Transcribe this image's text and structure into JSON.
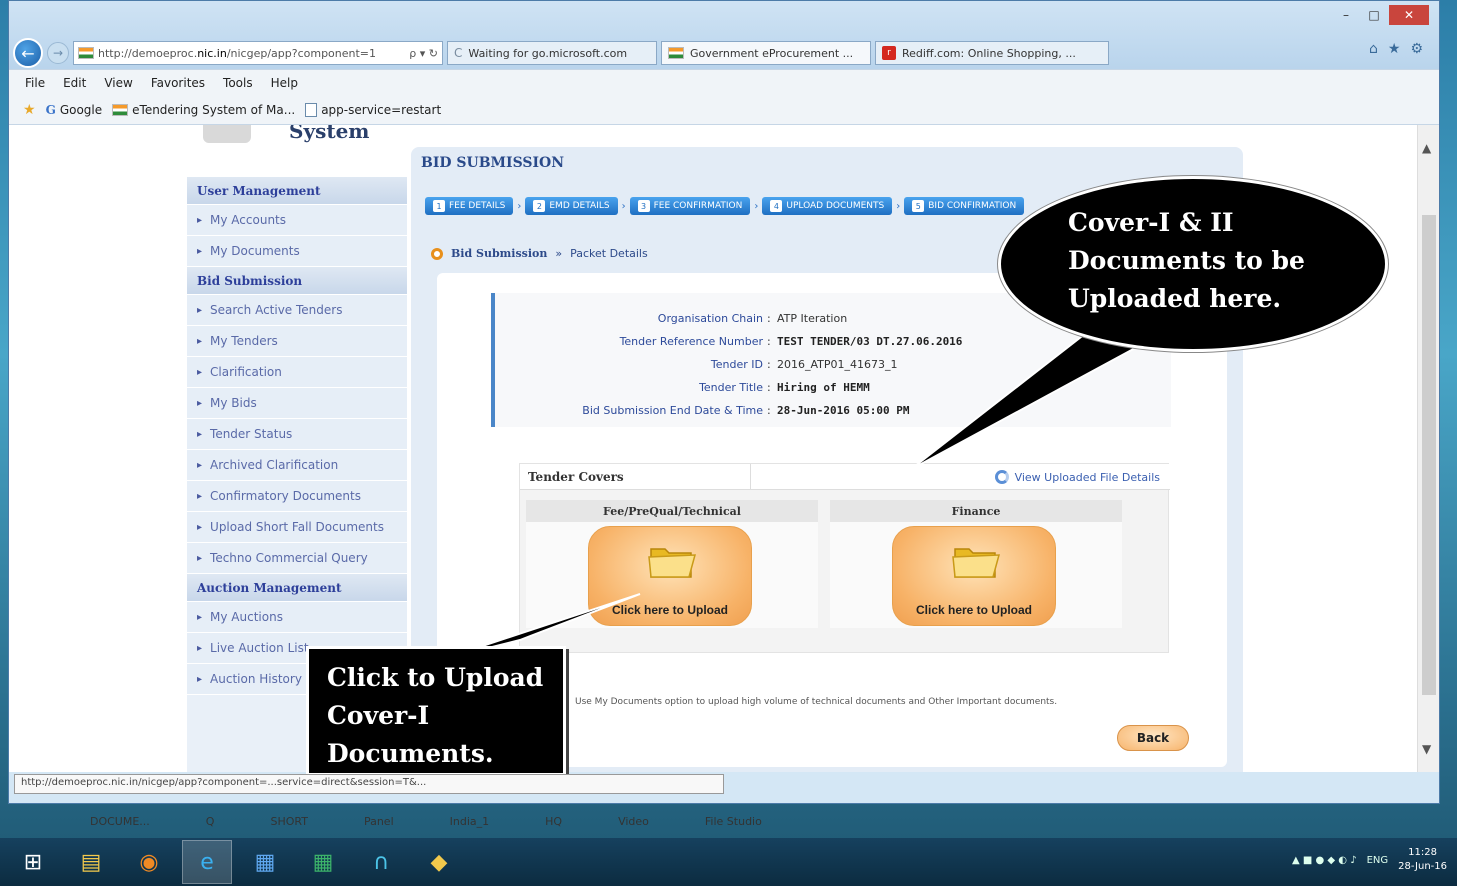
{
  "browser": {
    "window_controls": [
      "–",
      "□",
      "✕"
    ],
    "address_prefix": "http://demoeproc.",
    "address_domain": "nic.in",
    "address_suffix": "/nicgep/app?component=1",
    "address_icons": "ρ ▾ ↻",
    "tabs": [
      {
        "label": "Waiting for go.microsoft.com",
        "icon": "loading-icon"
      },
      {
        "label": "Government eProcurement ...",
        "icon": "india-flag-icon"
      },
      {
        "label": "Rediff.com: Online Shopping, ...",
        "icon": "rediff-icon"
      }
    ],
    "right_icons": [
      "⌂",
      "★",
      "⚙"
    ],
    "menu": [
      "File",
      "Edit",
      "View",
      "Favorites",
      "Tools",
      "Help"
    ],
    "favorites": [
      {
        "label": "Google",
        "icon": "google-icon"
      },
      {
        "label": "eTendering System of Ma...",
        "icon": "india-flag-icon"
      },
      {
        "label": "app-service=restart",
        "icon": "page-icon"
      }
    ],
    "status_url": "http://demoeproc.nic.in/nicgep/app?component=...service=direct&session=T&..."
  },
  "site": {
    "system_stub": "System",
    "section_title": "BID SUBMISSION",
    "steps": [
      {
        "num": "1",
        "label": "FEE DETAILS"
      },
      {
        "num": "2",
        "label": "EMD DETAILS"
      },
      {
        "num": "3",
        "label": "FEE CONFIRMATION"
      },
      {
        "num": "4",
        "label": "UPLOAD DOCUMENTS"
      },
      {
        "num": "5",
        "label": "BID CONFIRMATION"
      }
    ],
    "breadcrumb": {
      "root": "Bid Submission",
      "sep": "»",
      "current": "Packet Details"
    },
    "sidebar": {
      "user_mgmt": "User Management",
      "user_items": [
        "My Accounts",
        "My Documents"
      ],
      "bid_sub": "Bid Submission",
      "bid_items": [
        "Search Active Tenders",
        "My Tenders",
        "Clarification",
        "My Bids",
        "Tender Status",
        "Archived Clarification",
        "Confirmatory Documents",
        "Upload Short Fall Documents",
        "Techno Commercial Query"
      ],
      "auction_mgmt": "Auction Management",
      "auction_items": [
        "My Auctions",
        "Live Auction List",
        "Auction History"
      ]
    },
    "info": [
      {
        "label": "Organisation Chain",
        "value": "ATP Iteration",
        "bold": false
      },
      {
        "label": "Tender Reference Number",
        "value": "TEST TENDER/03 DT.27.06.2016",
        "bold": true
      },
      {
        "label": "Tender ID",
        "value": "2016_ATP01_41673_1",
        "bold": false
      },
      {
        "label": "Tender Title",
        "value": "Hiring of HEMM",
        "bold": true
      },
      {
        "label": "Bid Submission End Date & Time",
        "value": "28-Jun-2016 05:00 PM",
        "bold": true
      }
    ],
    "covers": {
      "title": "Tender Covers",
      "view_link": "View Uploaded File Details",
      "columns": [
        {
          "head": "Fee/PreQual/Technical",
          "button": "Click here to Upload"
        },
        {
          "head": "Finance",
          "button": "Click here to Upload"
        }
      ]
    },
    "note": "Use My Documents option to upload high volume of technical documents and Other Important documents.",
    "back": "Back"
  },
  "callouts": {
    "upload": "Click to Upload Cover-I Documents.",
    "bubble": "Cover-I & II Documents to be Uploaded here."
  },
  "desktop_strip": [
    "DOCUME...",
    "Q",
    "SHORT",
    "Panel",
    "India_1",
    "HQ",
    "Video",
    "File Studio"
  ],
  "taskbar": {
    "tray_lang": "ENG",
    "time": "11:28",
    "date": "28-Jun-16"
  }
}
